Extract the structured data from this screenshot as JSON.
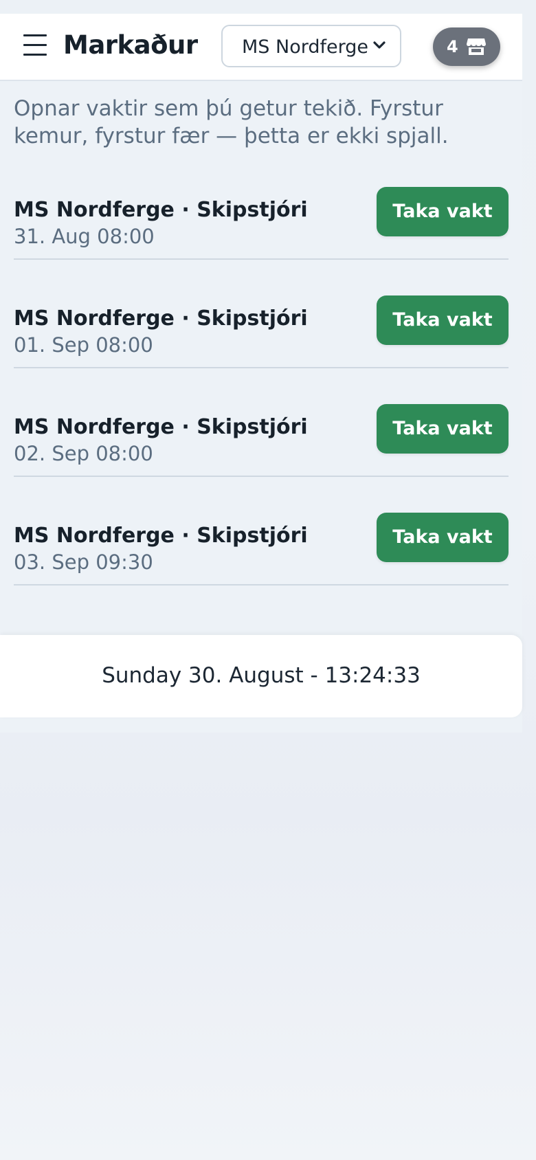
{
  "header": {
    "title": "Markaður",
    "vessel_select": {
      "selected": "MS Nordferge",
      "options": [
        "MS Nordferge"
      ]
    },
    "market_badge": {
      "count": "4",
      "icon": "store-icon"
    }
  },
  "intro": "Opnar vaktir sem þú getur tekið. Fyrstur kemur, fyrstur fær — þetta er ekki spjall.",
  "shifts": [
    {
      "title": "MS Nordferge · Skipstjóri",
      "when": "31. Aug 08:00",
      "action": "Taka vakt"
    },
    {
      "title": "MS Nordferge · Skipstjóri",
      "when": "01. Sep 08:00",
      "action": "Taka vakt"
    },
    {
      "title": "MS Nordferge · Skipstjóri",
      "when": "02. Sep 08:00",
      "action": "Taka vakt"
    },
    {
      "title": "MS Nordferge · Skipstjóri",
      "when": "03. Sep 09:30",
      "action": "Taka vakt"
    }
  ],
  "footer": {
    "clock": "Sunday 30. August - 13:24:33"
  },
  "colors": {
    "accent": "#2e8b57",
    "badge": "#6b717b",
    "muted_text": "#5b6d80"
  }
}
